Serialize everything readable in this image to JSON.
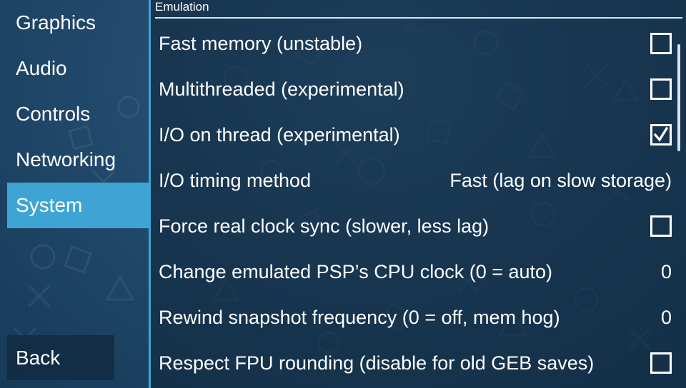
{
  "sidebar": {
    "tabs": [
      {
        "label": "Graphics",
        "selected": false
      },
      {
        "label": "Audio",
        "selected": false
      },
      {
        "label": "Controls",
        "selected": false
      },
      {
        "label": "Networking",
        "selected": false
      },
      {
        "label": "System",
        "selected": true
      }
    ],
    "back_label": "Back"
  },
  "content": {
    "section_title": "Emulation",
    "rows": [
      {
        "label": "Fast memory (unstable)",
        "type": "checkbox",
        "checked": false
      },
      {
        "label": "Multithreaded (experimental)",
        "type": "checkbox",
        "checked": false
      },
      {
        "label": "I/O on thread (experimental)",
        "type": "checkbox",
        "checked": true
      },
      {
        "label": "I/O timing method",
        "type": "value",
        "value": "Fast (lag on slow storage)"
      },
      {
        "label": "Force real clock sync (slower, less lag)",
        "type": "checkbox",
        "checked": false
      },
      {
        "label": "Change emulated PSP’s CPU clock (0 = auto)",
        "type": "value",
        "value": "0"
      },
      {
        "label": "Rewind snapshot frequency (0 = off, mem hog)",
        "type": "value",
        "value": "0"
      },
      {
        "label": "Respect FPU rounding (disable for old GEB saves)",
        "type": "checkbox",
        "checked": false
      }
    ]
  },
  "colors": {
    "accent": "#3ea4d3",
    "background": "#244d70"
  }
}
